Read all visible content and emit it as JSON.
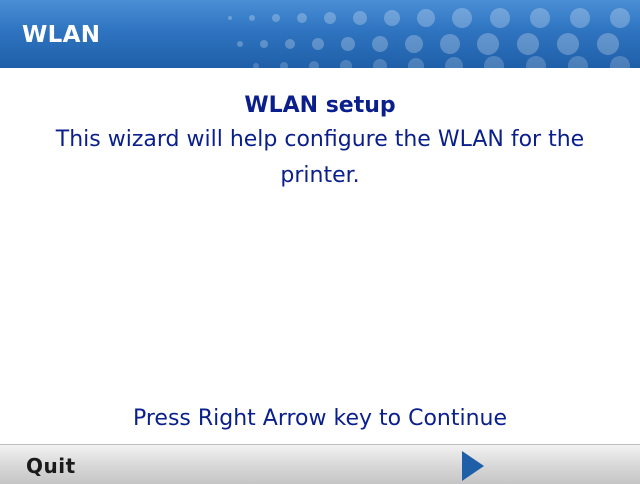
{
  "header": {
    "title": "WLAN"
  },
  "main": {
    "heading": "WLAN setup",
    "message": "This wizard will help configure the WLAN for the printer.",
    "prompt": "Press Right Arrow key to Continue"
  },
  "softkeys": {
    "left_label": "Quit",
    "right_icon": "right-arrow-icon"
  },
  "colors": {
    "title_bar": "#2f74c0",
    "text": "#0a1f8c",
    "arrow": "#1f5fa8"
  }
}
